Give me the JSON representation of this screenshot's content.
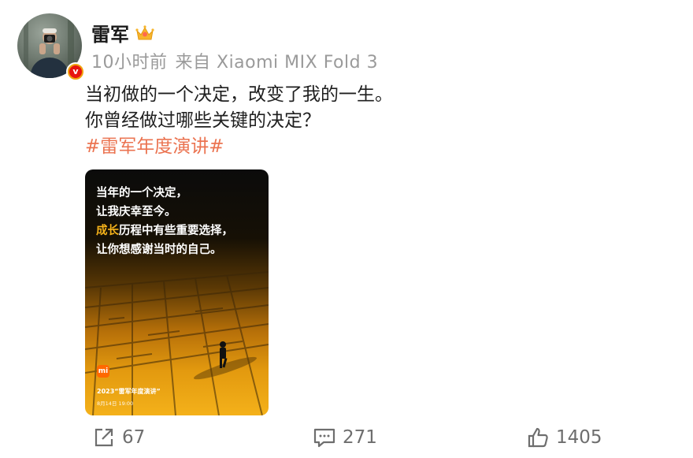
{
  "post": {
    "author": "雷军",
    "time": "10小时前",
    "source": "来自 Xiaomi MIX Fold 3",
    "lines": [
      "当初做的一个决定，改变了我的一生。",
      "你曾经做过哪些关键的决定？"
    ],
    "hashtag": "#雷军年度演讲#"
  },
  "poster": {
    "line1": "当年的一个决定，",
    "line2": "让我庆幸至今。",
    "line3_highlight": "成长",
    "line3_rest": "历程中有些重要选择，",
    "line4": "让你想感谢当时的自己。",
    "logo": "mi",
    "footer": "2023“雷军年度演讲”",
    "date": "8月14日 19:00"
  },
  "actions": {
    "repost_count": "67",
    "comment_count": "271",
    "like_count": "1405"
  },
  "colors": {
    "hashtag": "#eb7350",
    "meta": "#9a9a9a",
    "verified_badge": "#f0a20f"
  },
  "icons": [
    "crown-icon",
    "verified-icon",
    "repost-icon",
    "comment-icon",
    "like-icon"
  ]
}
